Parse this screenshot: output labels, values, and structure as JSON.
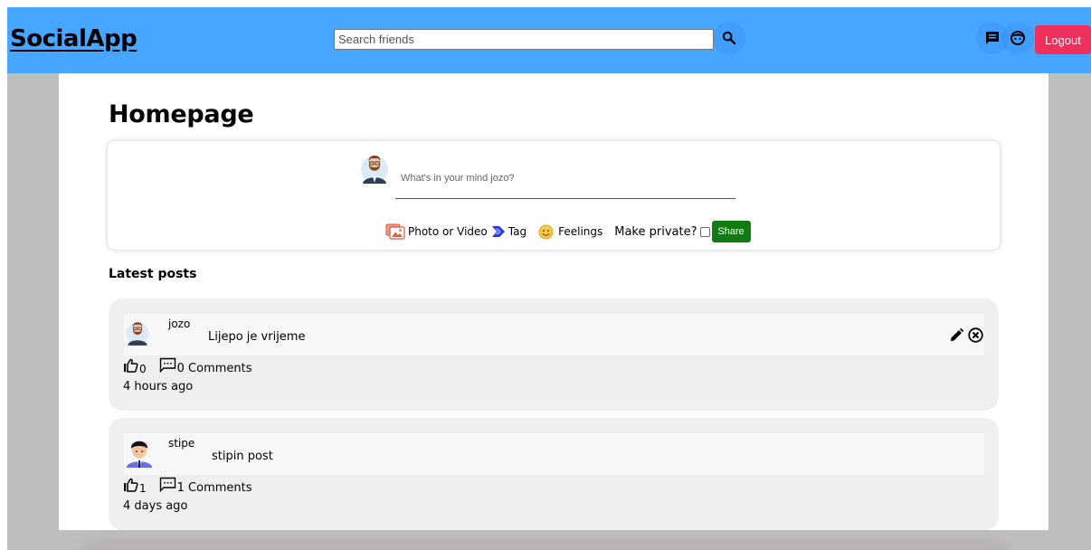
{
  "navbar": {
    "brand": "SocialApp",
    "search_placeholder": "Search friends",
    "logout_label": "Logout"
  },
  "page": {
    "title": "Homepage"
  },
  "composer": {
    "placeholder": "What's in your mind jozo?",
    "photo_label": "Photo or Video",
    "tag_label": "Tag",
    "feelings_label": "Feelings",
    "private_label": "Make private?",
    "private_checked": false,
    "share_label": "Share"
  },
  "feed": {
    "title": "Latest posts",
    "posts": [
      {
        "author": "jozo",
        "text": "Lijepo je vrijeme",
        "likes": "0",
        "comments": "0 Comments",
        "time": "4 hours ago",
        "editable": true
      },
      {
        "author": "stipe",
        "text": "stipin post",
        "likes": "1",
        "comments": "1 Comments",
        "time": "4 days ago",
        "editable": false
      }
    ]
  },
  "icons": {
    "search": "search-icon",
    "chat": "chat-icon",
    "profile": "profile-face-icon",
    "photo": "photo-gallery-icon",
    "tag": "tag-chevron-icon",
    "feelings": "smiley-icon",
    "like": "thumbs-up-icon",
    "comment": "comment-icon",
    "edit": "pencil-icon",
    "delete": "close-circle-icon"
  },
  "colors": {
    "navbar": "#47a6ff",
    "logout": "#ef2f5c",
    "share": "#107b10",
    "post_bg": "#efefef"
  }
}
